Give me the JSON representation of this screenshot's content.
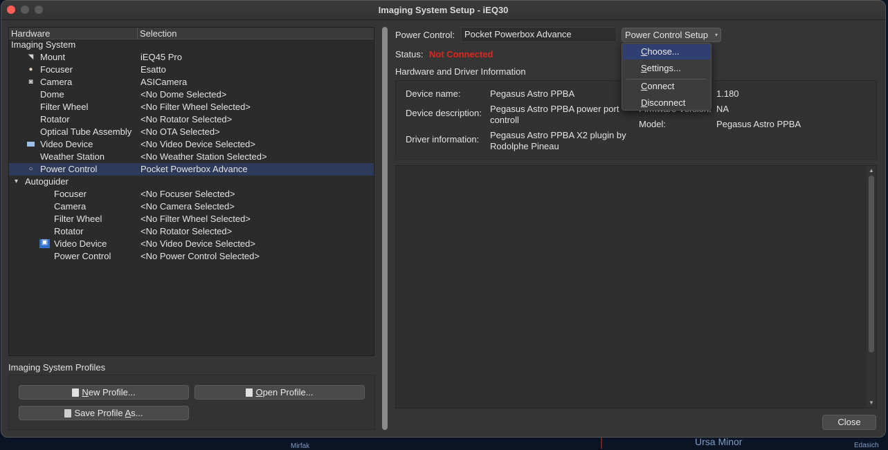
{
  "window": {
    "title": "Imaging System Setup - iEQ30"
  },
  "tree": {
    "col_hardware": "Hardware",
    "col_selection": "Selection",
    "rows": [
      {
        "hw": "Imaging System",
        "val": "",
        "level": 0,
        "icon": "none"
      },
      {
        "hw": "Mount",
        "val": "iEQ45 Pro",
        "level": 1,
        "icon": "mount-icon"
      },
      {
        "hw": "Focuser",
        "val": "Esatto",
        "level": 1,
        "icon": "focuser-icon"
      },
      {
        "hw": "Camera",
        "val": "ASICamera",
        "level": 1,
        "icon": "camera-icon"
      },
      {
        "hw": "Dome",
        "val": "<No Dome Selected>",
        "level": 1,
        "icon": "none"
      },
      {
        "hw": "Filter Wheel",
        "val": "<No Filter Wheel Selected>",
        "level": 1,
        "icon": "none"
      },
      {
        "hw": "Rotator",
        "val": "<No Rotator Selected>",
        "level": 1,
        "icon": "none"
      },
      {
        "hw": "Optical Tube Assembly",
        "val": "<No OTA Selected>",
        "level": 1,
        "icon": "none"
      },
      {
        "hw": "Video Device",
        "val": "<No Video Device Selected>",
        "level": 1,
        "icon": "video-icon"
      },
      {
        "hw": "Weather Station",
        "val": "<No Weather Station Selected>",
        "level": 1,
        "icon": "none"
      },
      {
        "hw": "Power Control",
        "val": "Pocket Powerbox Advance",
        "level": 1,
        "icon": "power-icon",
        "selected": true
      },
      {
        "hw": "Autoguider",
        "val": "",
        "level": 0,
        "icon": "expand-arrow-icon"
      },
      {
        "hw": "Focuser",
        "val": "<No Focuser Selected>",
        "level": 2,
        "icon": "none"
      },
      {
        "hw": "Camera",
        "val": "<No Camera Selected>",
        "level": 2,
        "icon": "none"
      },
      {
        "hw": "Filter Wheel",
        "val": "<No Filter Wheel Selected>",
        "level": 2,
        "icon": "none"
      },
      {
        "hw": "Rotator",
        "val": "<No Rotator Selected>",
        "level": 2,
        "icon": "none"
      },
      {
        "hw": "Video Device",
        "val": "<No Video Device Selected>",
        "level": 2,
        "icon": "video-icon-large"
      },
      {
        "hw": "Power Control",
        "val": "<No Power Control Selected>",
        "level": 2,
        "icon": "none"
      }
    ]
  },
  "profiles": {
    "title": "Imaging System Profiles",
    "new_label_u": "N",
    "new_label_rest": "ew Profile...",
    "open_label_u": "O",
    "open_label_rest": "pen Profile...",
    "save_label_pre": "Save Profile ",
    "save_label_u": "A",
    "save_label_rest": "s..."
  },
  "power": {
    "label": "Power Control:",
    "device": "Pocket Powerbox Advance",
    "setup_label": "Power Control Setup",
    "status_label": "Status:",
    "status_value": "Not Connected",
    "section_title": "Hardware and Driver Information"
  },
  "info": {
    "name_label": "Device name:",
    "name_value": "Pegasus Astro PPBA",
    "desc_label": "Device description:",
    "desc_value_1": "Pegasus Astro PPBA power port",
    "desc_value_2": "controll",
    "driver_label": "Driver information:",
    "driver_value_1": "Pegasus Astro PPBA X2 plugin by",
    "driver_value_2": "Rodolphe Pineau",
    "version_value": "1.180",
    "firmware_label": "Firmware Version:",
    "firmware_value": "NA",
    "model_label": "Model:",
    "model_value": "Pegasus Astro PPBA"
  },
  "menu": {
    "choose": {
      "u": "C",
      "rest": "hoose..."
    },
    "settings": {
      "u": "S",
      "rest": "ettings..."
    },
    "connect": {
      "u": "C",
      "rest": "onnect"
    },
    "disconnect": {
      "u": "D",
      "rest": "isconnect"
    }
  },
  "close_label": "Close",
  "sky": {
    "label_left": "Mirfak",
    "label_mid": "Ursa Minor",
    "label_right": "Edasich"
  },
  "colors": {
    "status_red": "#e0261f",
    "selection": "#2e3a5a",
    "menu_highlight": "#2f3f72"
  }
}
